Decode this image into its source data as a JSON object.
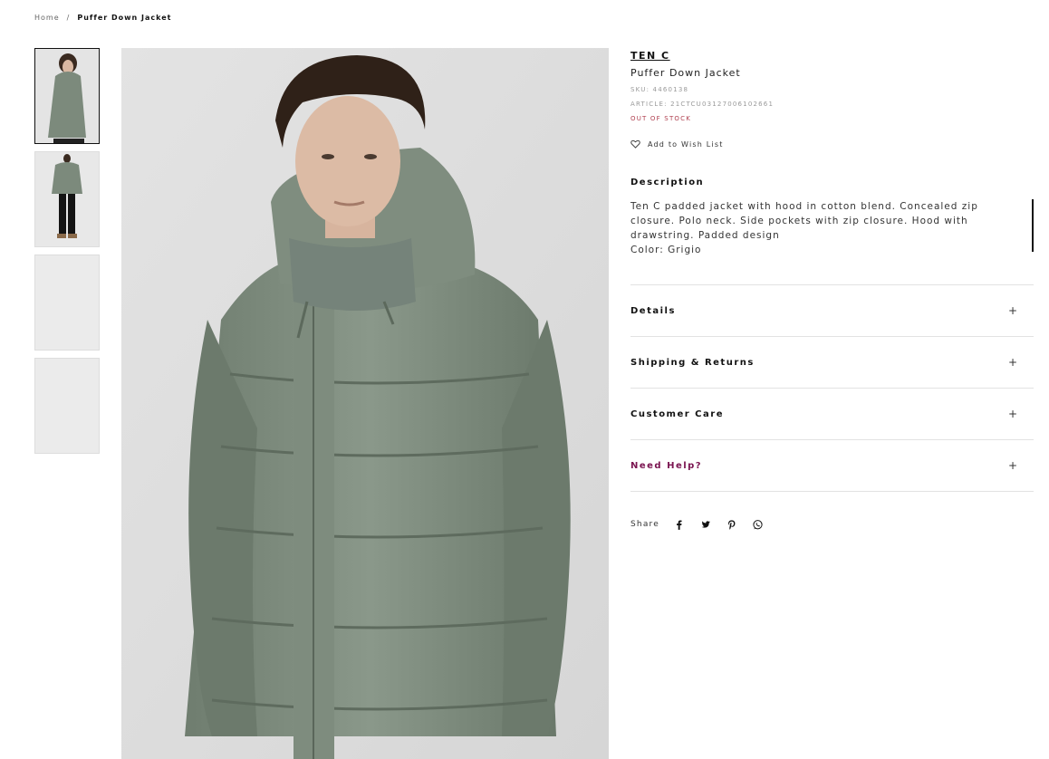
{
  "breadcrumb": {
    "home": "Home",
    "separator": "/",
    "current": "Puffer Down Jacket"
  },
  "gallery": {
    "thumbnails": [
      {
        "icon": "product-front-image"
      },
      {
        "icon": "product-full-image"
      },
      {
        "icon": "placeholder-image"
      },
      {
        "icon": "placeholder-image"
      }
    ],
    "main_image_icon": "product-model-image",
    "jacket_color": "#7c8a7c"
  },
  "product": {
    "brand": "TEN C",
    "title": "Puffer Down Jacket",
    "sku": "SKU: 4460138",
    "article": "ARTICLE: 21CTCU03127006102661",
    "stock": "OUT OF STOCK",
    "wishlist": "Add to Wish List"
  },
  "description": {
    "heading": "Description",
    "text": "Ten C padded jacket with hood in cotton blend. Concealed zip closure. Polo neck. Side pockets with zip closure. Hood with drawstring. Padded design",
    "color": "Color: Grigio"
  },
  "accordion": [
    {
      "label": "Details",
      "icon": "plus-icon"
    },
    {
      "label": "Shipping & Returns",
      "icon": "plus-icon"
    },
    {
      "label": "Customer Care",
      "icon": "plus-icon"
    },
    {
      "label": "Need Help?",
      "icon": "plus-icon"
    }
  ],
  "share": {
    "label": "Share",
    "icons": [
      "facebook-icon",
      "twitter-icon",
      "pinterest-icon",
      "whatsapp-icon"
    ]
  },
  "colors": {
    "accent": "#7a1450",
    "stock": "#b04050"
  }
}
